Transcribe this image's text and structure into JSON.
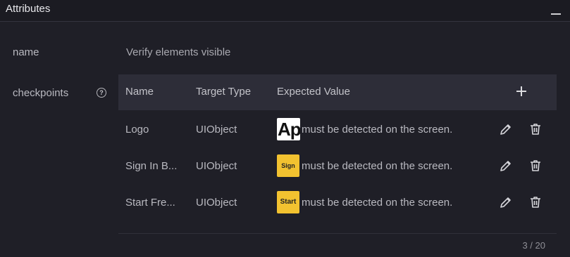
{
  "header": {
    "title": "Attributes"
  },
  "fields": {
    "name_label": "name",
    "name_value": "Verify elements visible",
    "checkpoints_label": "checkpoints",
    "help_glyph": "?"
  },
  "table": {
    "columns": [
      "Name",
      "Target Type",
      "Expected Value"
    ],
    "rows": [
      {
        "name": "Logo",
        "target_type": "UIObject",
        "thumb_text": "App",
        "expected": "must be detected on the screen."
      },
      {
        "name": "Sign In B...",
        "target_type": "UIObject",
        "thumb_text": "Sign",
        "expected": "must be detected on the screen."
      },
      {
        "name": "Start Fre...",
        "target_type": "UIObject",
        "thumb_text": "Start",
        "expected": "must be detected on the screen."
      }
    ]
  },
  "pager": {
    "text": "3 / 20"
  },
  "colors": {
    "background": "#1f1f27",
    "table_header": "#2d2d38",
    "thumb_yellow": "#f2c230"
  },
  "icons": [
    "minimize-icon",
    "help-icon",
    "plus-icon",
    "pencil-icon",
    "trash-icon"
  ]
}
